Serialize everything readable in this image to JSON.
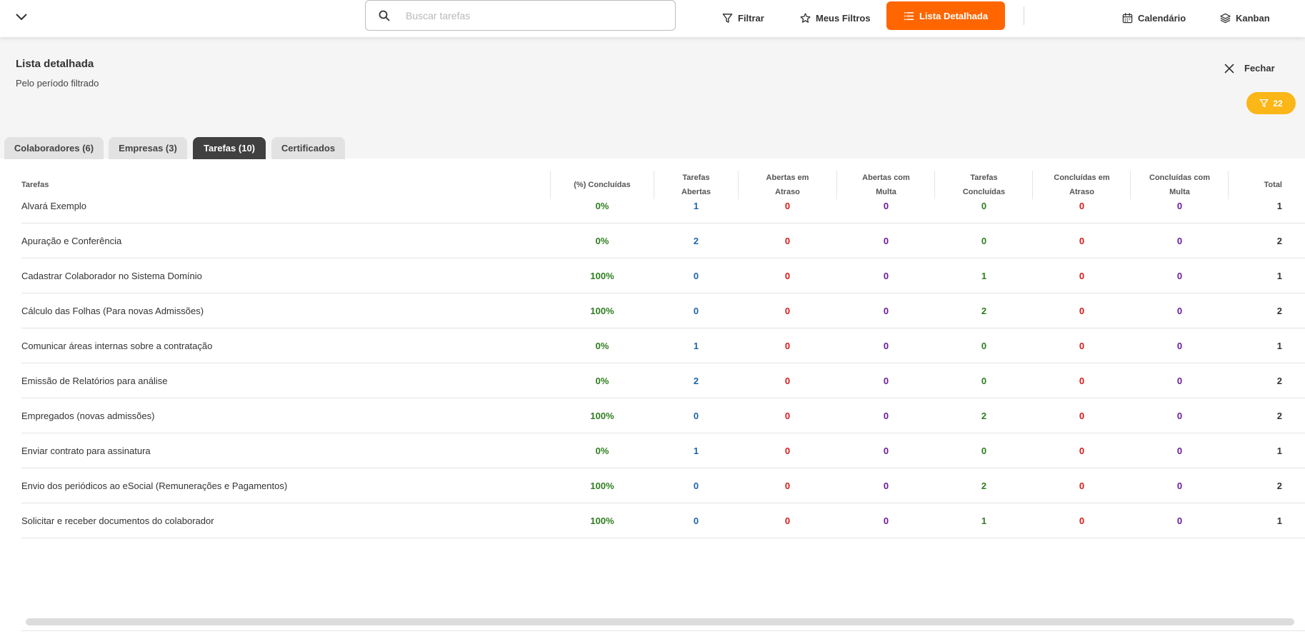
{
  "toolbar": {
    "search_placeholder": "Buscar tarefas",
    "filter_label": "Filtrar",
    "my_filters_label": "Meus Filtros",
    "detailed_list_label": "Lista Detalhada",
    "calendar_label": "Calendário",
    "kanban_label": "Kanban",
    "accent_color": "#ff6600"
  },
  "header": {
    "title": "Lista detalhada",
    "subtitle": "Pelo período filtrado",
    "close_label": "Fechar",
    "filter_count": "22",
    "badge_color": "#fbb617"
  },
  "tabs": [
    {
      "label": "Colaboradores (6)",
      "active": false
    },
    {
      "label": "Empresas (3)",
      "active": false
    },
    {
      "label": "Tarefas (10)",
      "active": true
    },
    {
      "label": "Certificados",
      "active": false
    }
  ],
  "table": {
    "headers": {
      "name": "Tarefas",
      "pct": "(%) Concluídas",
      "open_1": "Tarefas",
      "open_2": "Abertas",
      "open_late_1": "Abertas em",
      "open_late_2": "Atraso",
      "open_fine_1": "Abertas com",
      "open_fine_2": "Multa",
      "done_1": "Tarefas",
      "done_2": "Concluídas",
      "done_late_1": "Concluídas em",
      "done_late_2": "Atraso",
      "done_fine_1": "Concluídas com",
      "done_fine_2": "Multa",
      "total": "Total"
    },
    "colors": {
      "pct": "#2e7d1f",
      "open": "#1e63a8",
      "late": "#d41a1a",
      "fine": "#6a1b9a",
      "done": "#2e7d1f",
      "total": "#333333"
    },
    "rows": [
      {
        "name": "Alvará Exemplo",
        "pct": "0%",
        "open": "1",
        "open_late": "0",
        "open_fine": "0",
        "done": "0",
        "done_late": "0",
        "done_fine": "0",
        "total": "1"
      },
      {
        "name": "Apuração e Conferência",
        "pct": "0%",
        "open": "2",
        "open_late": "0",
        "open_fine": "0",
        "done": "0",
        "done_late": "0",
        "done_fine": "0",
        "total": "2"
      },
      {
        "name": "Cadastrar Colaborador no Sistema Domínio",
        "pct": "100%",
        "open": "0",
        "open_late": "0",
        "open_fine": "0",
        "done": "1",
        "done_late": "0",
        "done_fine": "0",
        "total": "1"
      },
      {
        "name": "Cálculo das Folhas (Para novas Admissões)",
        "pct": "100%",
        "open": "0",
        "open_late": "0",
        "open_fine": "0",
        "done": "2",
        "done_late": "0",
        "done_fine": "0",
        "total": "2"
      },
      {
        "name": "Comunicar áreas internas sobre a contratação",
        "pct": "0%",
        "open": "1",
        "open_late": "0",
        "open_fine": "0",
        "done": "0",
        "done_late": "0",
        "done_fine": "0",
        "total": "1"
      },
      {
        "name": "Emissão de Relatórios para análise",
        "pct": "0%",
        "open": "2",
        "open_late": "0",
        "open_fine": "0",
        "done": "0",
        "done_late": "0",
        "done_fine": "0",
        "total": "2"
      },
      {
        "name": "Empregados (novas admissões)",
        "pct": "100%",
        "open": "0",
        "open_late": "0",
        "open_fine": "0",
        "done": "2",
        "done_late": "0",
        "done_fine": "0",
        "total": "2"
      },
      {
        "name": "Enviar contrato para assinatura",
        "pct": "0%",
        "open": "1",
        "open_late": "0",
        "open_fine": "0",
        "done": "0",
        "done_late": "0",
        "done_fine": "0",
        "total": "1"
      },
      {
        "name": "Envio dos periódicos ao eSocial (Remunerações e Pagamentos)",
        "pct": "100%",
        "open": "0",
        "open_late": "0",
        "open_fine": "0",
        "done": "2",
        "done_late": "0",
        "done_fine": "0",
        "total": "2"
      },
      {
        "name": "Solicitar e receber documentos do colaborador",
        "pct": "100%",
        "open": "0",
        "open_late": "0",
        "open_fine": "0",
        "done": "1",
        "done_late": "0",
        "done_fine": "0",
        "total": "1"
      }
    ]
  }
}
